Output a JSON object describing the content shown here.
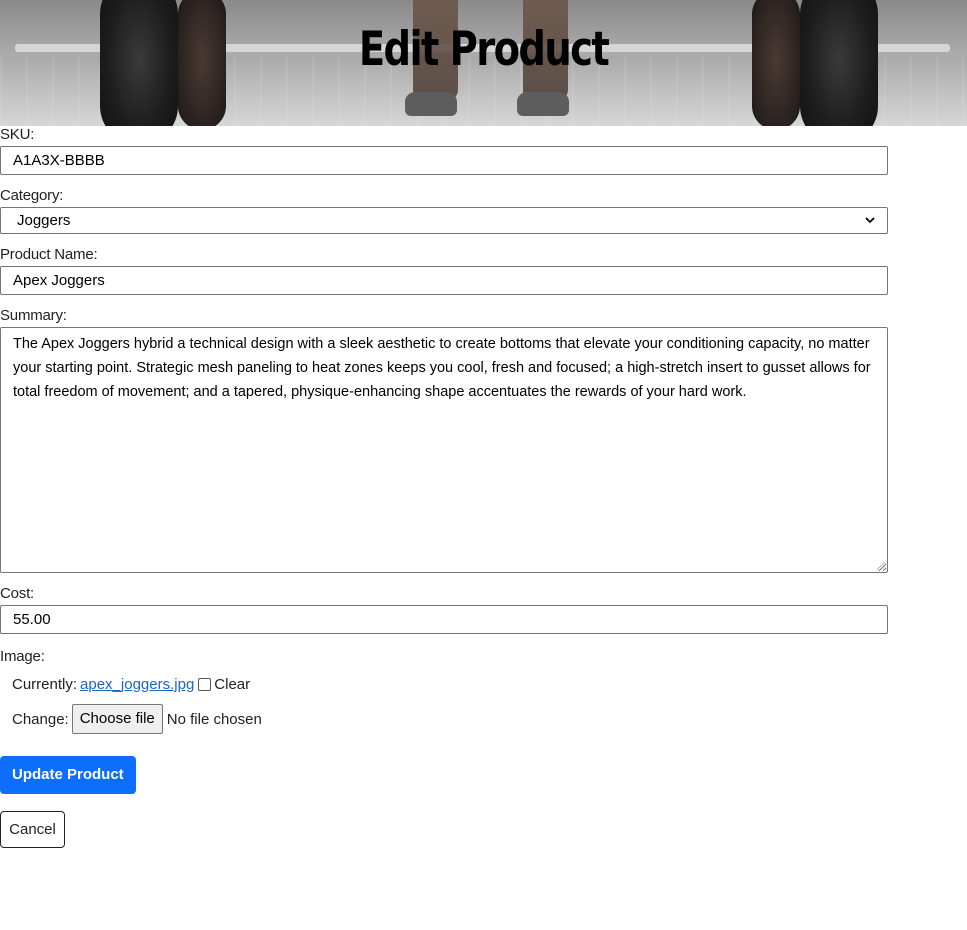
{
  "page": {
    "title": "Edit Product"
  },
  "form": {
    "sku": {
      "label": "SKU:",
      "value": "A1A3X-BBBB"
    },
    "category": {
      "label": "Category:",
      "selected": "Joggers"
    },
    "product_name": {
      "label": "Product Name:",
      "value": "Apex Joggers"
    },
    "summary": {
      "label": "Summary:",
      "value": "The Apex Joggers hybrid a technical design with a sleek aesthetic to create bottoms that elevate your conditioning capacity, no matter your starting point. Strategic mesh paneling to heat zones keeps you cool, fresh and focused; a high-stretch insert to gusset allows for total freedom of movement; and a tapered, physique-enhancing shape accentuates the rewards of your hard work."
    },
    "cost": {
      "label": "Cost:",
      "value": "55.00"
    },
    "image": {
      "label": "Image:",
      "currently_label": "Currently:",
      "current_file": "apex_joggers.jpg",
      "clear_label": "Clear",
      "change_label": "Change:",
      "choose_file_label": "Choose file",
      "no_file_text": "No file chosen"
    },
    "submit_label": "Update Product",
    "cancel_label": "Cancel"
  },
  "colors": {
    "primary": "#0d6efd",
    "link": "#1a66cc"
  }
}
